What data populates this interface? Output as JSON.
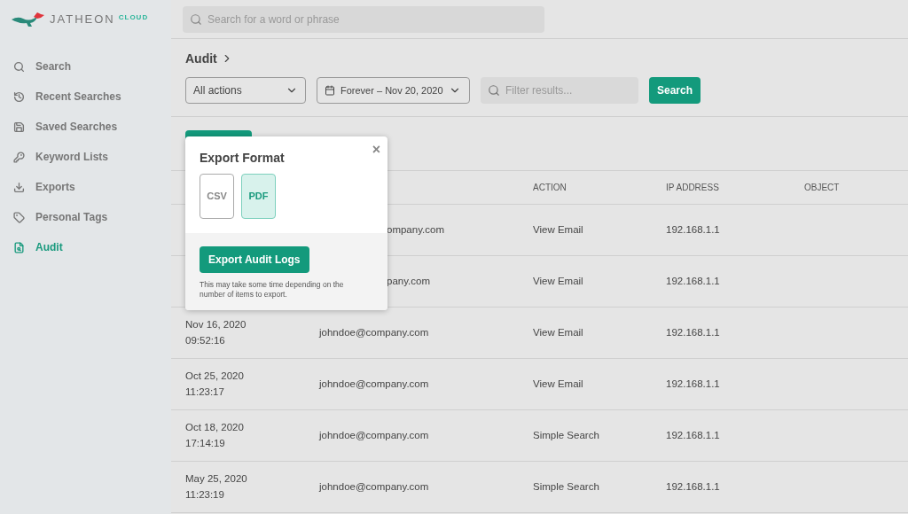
{
  "brand": {
    "name": "JATHEON",
    "suffix": "CLOUD"
  },
  "top_search": {
    "placeholder": "Search for a word or phrase"
  },
  "sidebar": {
    "items": [
      {
        "label": "Search",
        "selected": false
      },
      {
        "label": "Recent Searches",
        "selected": false
      },
      {
        "label": "Saved Searches",
        "selected": false
      },
      {
        "label": "Keyword Lists",
        "selected": false
      },
      {
        "label": "Exports",
        "selected": false
      },
      {
        "label": "Personal Tags",
        "selected": false
      },
      {
        "label": "Audit",
        "selected": true
      }
    ]
  },
  "breadcrumb": {
    "title": "Audit"
  },
  "filters": {
    "action": "All actions",
    "date_range": "Forever – Nov 20, 2020",
    "filter_placeholder": "Filter results...",
    "search_button": "Search"
  },
  "table": {
    "columns": [
      "ACTION",
      "IP ADDRESS",
      "OBJECT"
    ],
    "rows": [
      {
        "date": "",
        "time": "",
        "user": "ompany.com",
        "action": "View Email",
        "ip": "192.168.1.1"
      },
      {
        "date": "",
        "time": "",
        "user": "pany.com",
        "action": "View Email",
        "ip": "192.168.1.1"
      },
      {
        "date": "Nov 16, 2020",
        "time": "09:52:16",
        "user": "johndoe@company.com",
        "action": "View Email",
        "ip": "192.168.1.1"
      },
      {
        "date": "Oct 25, 2020",
        "time": "11:23:17",
        "user": "johndoe@company.com",
        "action": "View Email",
        "ip": "192.168.1.1"
      },
      {
        "date": "Oct 18, 2020",
        "time": "17:14:19",
        "user": "johndoe@company.com",
        "action": "Simple Search",
        "ip": "192.168.1.1"
      },
      {
        "date": "May 25, 2020",
        "time": "11:23:19",
        "user": "johndoe@company.com",
        "action": "Simple Search",
        "ip": "192.168.1.1"
      }
    ]
  },
  "popover": {
    "title": "Export Format",
    "close": "×",
    "formats": [
      {
        "label": "CSV",
        "selected": false
      },
      {
        "label": "PDF",
        "selected": true
      }
    ],
    "export_button": "Export Audit Logs",
    "note": "This may take some time depending on the number of items to export."
  }
}
